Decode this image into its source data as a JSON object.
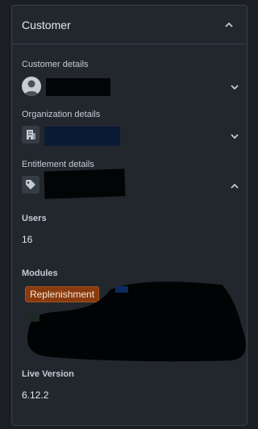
{
  "panel": {
    "title": "Customer",
    "header_icon": "chevron-up-icon"
  },
  "sections": {
    "customer_details": {
      "label": "Customer details",
      "icon": "user-avatar-icon",
      "toggle_icon": "chevron-down-icon"
    },
    "organization_details": {
      "label": "Organization details",
      "icon": "building-icon",
      "toggle_icon": "chevron-down-icon"
    },
    "entitlement_details": {
      "label": "Entitlement details",
      "icon": "tag-icon",
      "toggle_icon": "chevron-up-icon"
    }
  },
  "entitlement": {
    "users_label": "Users",
    "users_value": "16",
    "modules_label": "Modules",
    "modules": [
      "Replenishment"
    ],
    "live_version_label": "Live Version",
    "live_version_value": "6.12.2"
  },
  "colors": {
    "background": "#1b1f24",
    "panel": "#22272e",
    "border": "#39414b",
    "tag_background": "#8a3a0c"
  }
}
